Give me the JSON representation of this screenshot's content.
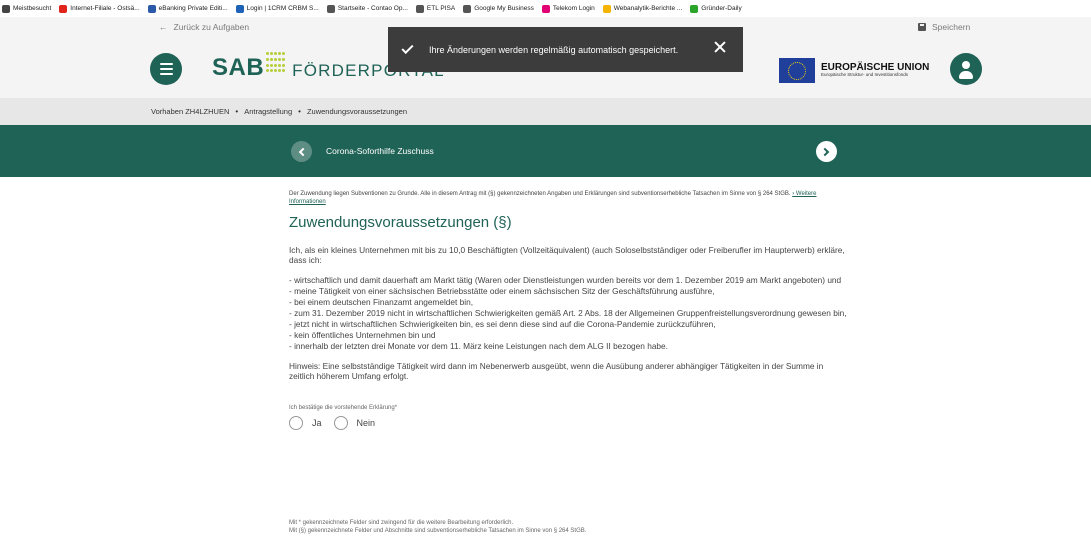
{
  "bookmarks": [
    {
      "label": "Meistbesucht",
      "icon": "gear-icon",
      "color": "#444444"
    },
    {
      "label": "Internet-Filiale - Ostsä...",
      "icon": "bank-icon",
      "color": "#e2231a"
    },
    {
      "label": "eBanking Private Editi...",
      "icon": "bank-icon",
      "color": "#2a5aa8"
    },
    {
      "label": "Login | 1CRM CRBM S...",
      "icon": "crm-icon",
      "color": "#1d62b5"
    },
    {
      "label": "Startseite - Contao Op...",
      "icon": "globe-icon",
      "color": "#555555"
    },
    {
      "label": "ETL PISA",
      "icon": "globe-icon",
      "color": "#555555"
    },
    {
      "label": "Google My Business",
      "icon": "globe-icon",
      "color": "#555555"
    },
    {
      "label": "Telekom Login",
      "icon": "telekom-icon",
      "color": "#e20074"
    },
    {
      "label": "Webanalytik-Berichte ...",
      "icon": "analytics-icon",
      "color": "#f5b400"
    },
    {
      "label": "Gründer-Daily",
      "icon": "link-icon",
      "color": "#2aa52a"
    }
  ],
  "topbar": {
    "back_label": "Zurück zu Aufgaben",
    "save_label": "Speichern"
  },
  "header": {
    "logo_brand": "SAB",
    "logo_text": "FÖRDERPORTAL",
    "eu_title": "EUROPÄISCHE UNION",
    "eu_subtitle": "Europäische Struktur- und Investitionsfonds"
  },
  "toast": {
    "message": "Ihre Änderungen werden regelmäßig automatisch gespeichert."
  },
  "breadcrumb": {
    "items": [
      "Vorhaben ZH4LZHUEN",
      "Antragstellung",
      "Zuwendungsvoraussetzungen"
    ],
    "separator": "•"
  },
  "stepper": {
    "title": "Corona-Soforthilfe Zuschuss"
  },
  "content": {
    "intro": "Der Zuwendung liegen Subventionen zu Grunde. Alle in diesem Antrag mit (§) gekennzeichneten Angaben und Erklärungen sind subventionserhebliche Tatsachen im Sinne von § 264 StGB.",
    "intro_link": "› Weitere Informationen",
    "heading": "Zuwendungsvoraussetzungen (§)",
    "lead": "Ich, als ein kleines Unternehmen mit bis zu 10,0 Beschäftigten (Vollzeitäquivalent) (auch Soloselbstständiger oder Freiberufler im Haupterwerb) erkläre, dass ich:",
    "conditions": [
      "- wirtschaftlich und damit dauerhaft am Markt tätig (Waren oder Dienstleistungen wurden bereits vor dem 1. Dezember 2019 am Markt angeboten) und",
      "- meine Tätigkeit von einer sächsischen Betriebsstätte oder einem sächsischen Sitz der Geschäftsführung ausführe,",
      "- bei einem deutschen Finanzamt angemeldet bin,",
      "- zum 31. Dezember 2019 nicht in wirtschaftlichen Schwierigkeiten gemäß Art. 2 Abs. 18 der Allgemeinen Gruppenfreistellungsverordnung gewesen bin,",
      "- jetzt nicht in wirtschaftlichen Schwierigkeiten bin, es sei denn diese sind auf die Corona-Pandemie zurückzuführen,",
      "- kein öffentliches Unternehmen bin und",
      "- innerhalb der letzten drei Monate vor dem 11. März keine Leistungen nach dem ALG II bezogen habe."
    ],
    "hint": "Hinweis: Eine selbstständige Tätigkeit wird dann im Nebenerwerb ausgeübt, wenn die Ausübung anderer abhängiger Tätigkeiten in der Summe in zeitlich höherem Umfang erfolgt.",
    "confirm_label": "Ich bestätige die vorstehende Erklärung*",
    "options": {
      "yes": "Ja",
      "no": "Nein"
    },
    "selected": ""
  },
  "footnotes": {
    "required": "Mit * gekennzeichnete Felder sind zwingend für die weitere Bearbeitung erforderlich.",
    "subsidy": "Mit (§) gekennzeichnete Felder und Abschnitte sind subventionserhebliche Tatsachen im Sinne von § 264 StGB."
  },
  "colors": {
    "brand_green": "#1f6256",
    "logo_dots": "#b6cf3a",
    "toast_bg": "#3c3c3c"
  }
}
